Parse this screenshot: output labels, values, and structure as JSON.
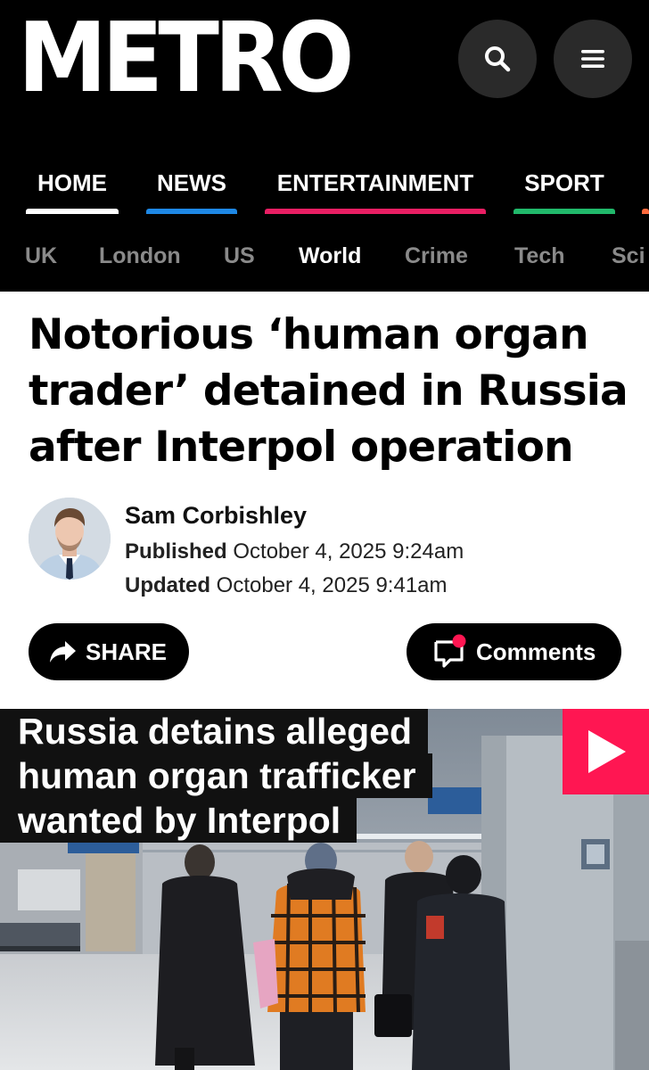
{
  "header": {
    "logo": "METRO",
    "search_icon": "search-icon",
    "menu_icon": "hamburger-menu-icon"
  },
  "nav": {
    "items": [
      {
        "label": "HOME",
        "color": "#ffffff"
      },
      {
        "label": "NEWS",
        "color": "#1e88e5"
      },
      {
        "label": "ENTERTAINMENT",
        "color": "#e91e63"
      },
      {
        "label": "SPORT",
        "color": "#21b96b"
      }
    ],
    "extra_color": "#ff6a3d"
  },
  "subnav": {
    "items": [
      "UK",
      "London",
      "US",
      "World",
      "Crime",
      "Tech",
      "Sci"
    ],
    "active": "World"
  },
  "article": {
    "headline_lines": [
      "Notorious ‘human organ",
      "trader’ detained in Russia",
      "after Interpol operation"
    ],
    "author": "Sam Corbishley",
    "published_label": "Published",
    "published": "October 4, 2025 9:24am",
    "updated_label": "Updated",
    "updated": "October 4, 2025 9:41am"
  },
  "actions": {
    "share": "SHARE",
    "comments": "Comments",
    "notification_color": "#ff1652"
  },
  "video": {
    "caption_lines": [
      "Russia detains alleged",
      "human organ trafficker",
      "wanted by Interpol"
    ],
    "play_color": "#ff1652"
  }
}
